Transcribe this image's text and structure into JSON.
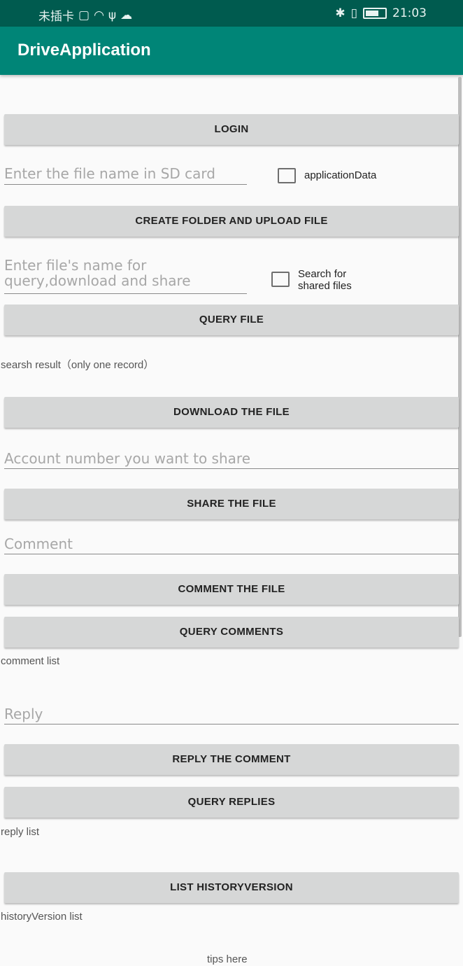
{
  "status_bar": {
    "carrier": "未插卡",
    "time": "21:03"
  },
  "app": {
    "title": "DriveApplication"
  },
  "buttons": {
    "login": "LOGIN",
    "create_upload": "CREATE FOLDER AND UPLOAD FILE",
    "query_file": "QUERY FILE",
    "download": "DOWNLOAD THE FILE",
    "share": "SHARE THE FILE",
    "comment": "COMMENT THE FILE",
    "query_comments": "QUERY COMMENTS",
    "reply": "REPLY THE COMMENT",
    "query_replies": "QUERY REPLIES",
    "list_history": "LIST HISTORYVERSION"
  },
  "fields": {
    "sd_file_placeholder": "Enter the file name in SD card",
    "query_file_placeholder": "Enter file's name for query,download and share",
    "account_placeholder": "Account number you want to share",
    "comment_placeholder": "Comment",
    "reply_placeholder": "Reply"
  },
  "checkboxes": {
    "application_data": "applicationData",
    "shared_files": "Search for shared files"
  },
  "labels": {
    "search_result": "searsh result（only one record）",
    "comment_list": "comment list",
    "reply_list": "reply list",
    "history_list": "historyVersion list",
    "tips": "tips here"
  }
}
